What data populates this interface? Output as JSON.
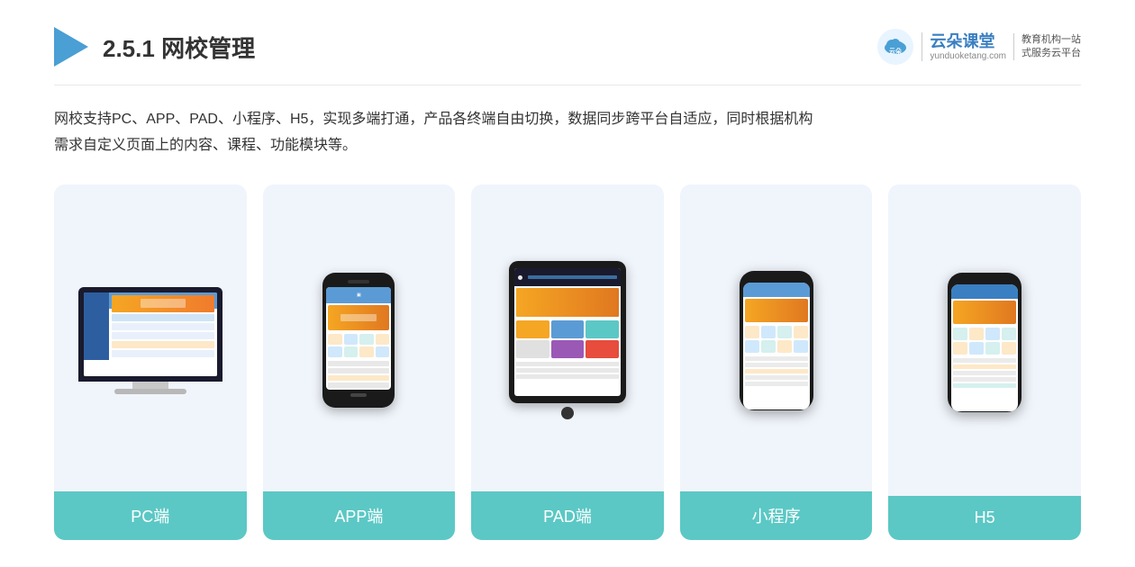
{
  "header": {
    "title_prefix": "2.5.1 ",
    "title_bold": "网校管理",
    "brand": {
      "name": "云朵课堂",
      "url": "yunduoketang.com",
      "slogan_line1": "教育机构一站",
      "slogan_line2": "式服务云平台"
    }
  },
  "description": {
    "text_line1": "网校支持PC、APP、PAD、小程序、H5，实现多端打通，产品各终端自由切换，数据同步跨平台自适应，同时根据机构",
    "text_line2": "需求自定义页面上的内容、课程、功能模块等。"
  },
  "cards": [
    {
      "id": "pc",
      "label": "PC端"
    },
    {
      "id": "app",
      "label": "APP端"
    },
    {
      "id": "pad",
      "label": "PAD端"
    },
    {
      "id": "miniprogram",
      "label": "小程序"
    },
    {
      "id": "h5",
      "label": "H5"
    }
  ]
}
